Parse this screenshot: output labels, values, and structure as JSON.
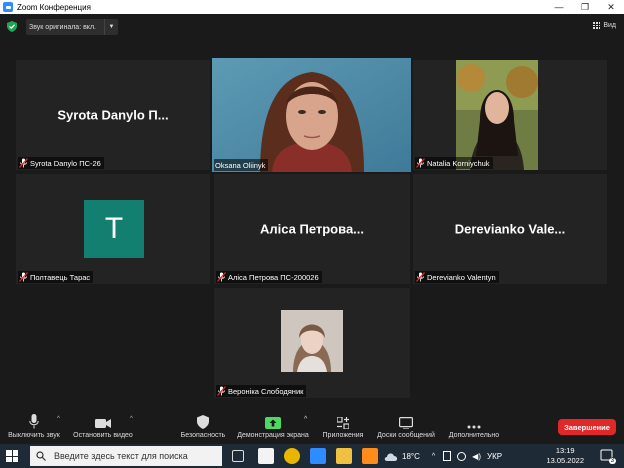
{
  "window": {
    "title": "Zoom Конференция"
  },
  "topbar": {
    "audio_label": "Звук оригинала: вкл.",
    "view_label": "Вид"
  },
  "participants": [
    {
      "display": "Syrota Danylo П...",
      "label": "Syrota Danylo ПС-26",
      "muted": true,
      "video": false
    },
    {
      "display": "",
      "label": "Oksana Oliinyk",
      "muted": false,
      "video": true,
      "active": true
    },
    {
      "display": "",
      "label": "Natalia Korniychuk",
      "muted": true,
      "video": true
    },
    {
      "display": "T",
      "label": "Полтавець Тарас",
      "muted": true,
      "video": false
    },
    {
      "display": "Аліса Петрова...",
      "label": "Аліса Петрова ПС-200026",
      "muted": true,
      "video": false
    },
    {
      "display": "Derevianko Vale...",
      "label": "Derevianko Valentyn",
      "muted": true,
      "video": false
    },
    {
      "display": "",
      "label": "Вероніка Слободяник",
      "muted": true,
      "video": false,
      "photo": true
    }
  ],
  "toolbar": {
    "mute": "Выключить звук",
    "video": "Остановить видео",
    "security": "Безопасность",
    "share": "Демонстрация экрана",
    "apps": "Приложения",
    "whiteboard": "Доски сообщений",
    "more": "Дополнительно",
    "end": "Завершение"
  },
  "taskbar": {
    "search_placeholder": "Введите здесь текст для поиска",
    "weather": "18°C",
    "language": "УКР",
    "time": "13:19",
    "date": "13.05.2022",
    "notifications": "3"
  },
  "colors": {
    "active_border": "#c9e265",
    "share_green": "#4cd964",
    "end_red": "#e02828",
    "avatar_teal": "#127f70"
  }
}
